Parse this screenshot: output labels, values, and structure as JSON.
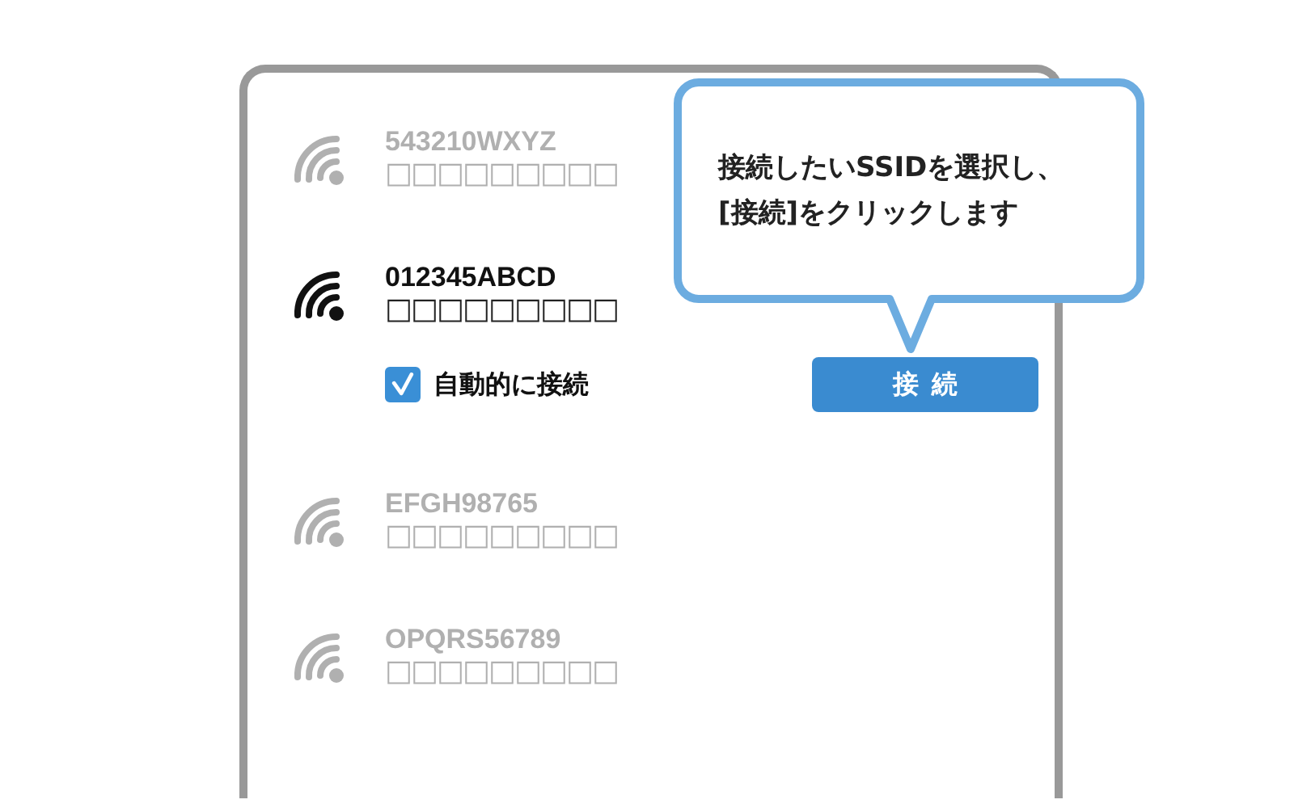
{
  "networks": [
    {
      "ssid": "543210WXYZ",
      "detail": "□□□□□□□□□",
      "selected": false
    },
    {
      "ssid": "012345ABCD",
      "detail": "□□□□□□□□□",
      "selected": true,
      "auto_connect": {
        "label": "自動的に接続",
        "checked": true
      },
      "connect_button": "接続"
    },
    {
      "ssid": "EFGH98765",
      "detail": "□□□□□□□□□",
      "selected": false
    },
    {
      "ssid": "OPQRS56789",
      "detail": "□□□□□□□□□",
      "selected": false
    }
  ],
  "callout": {
    "text": "接続したいSSIDを選択し、\n[接続]をクリックします"
  }
}
